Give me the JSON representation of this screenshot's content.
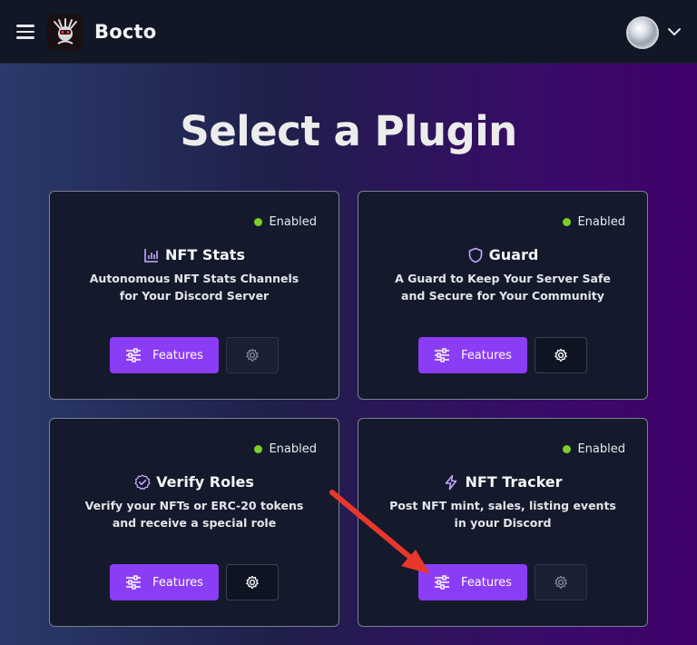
{
  "app": {
    "name": "Bocto"
  },
  "page": {
    "title": "Select a Plugin"
  },
  "colors": {
    "accent": "#8a3df5",
    "enabled": "#7ccf2b",
    "annotation_arrow": "#e8372d"
  },
  "plugins": [
    {
      "title": "NFT Stats",
      "icon": "bar-chart-icon",
      "status": "Enabled",
      "description_line1": "Autonomous NFT Stats Channels",
      "description_line2": "for Your Discord Server",
      "features_label": "Features"
    },
    {
      "title": "Guard",
      "icon": "shield-icon",
      "status": "Enabled",
      "description_line1": "A Guard to Keep Your Server Safe",
      "description_line2": "and Secure for Your Community",
      "features_label": "Features"
    },
    {
      "title": "Verify Roles",
      "icon": "verified-check-icon",
      "status": "Enabled",
      "description_line1": "Verify your NFTs or ERC-20 tokens",
      "description_line2": "and receive a special role",
      "features_label": "Features"
    },
    {
      "title": "NFT Tracker",
      "icon": "lightning-icon",
      "status": "Enabled",
      "description_line1": "Post NFT mint, sales, listing events",
      "description_line2": "in your Discord",
      "features_label": "Features"
    }
  ]
}
